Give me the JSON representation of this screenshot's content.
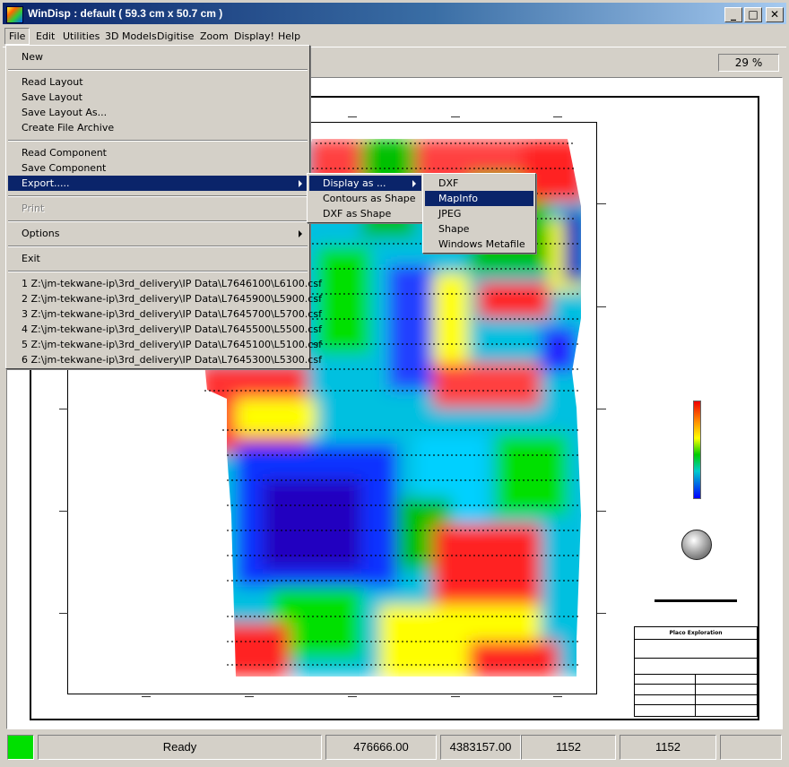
{
  "window": {
    "title": "WinDisp : default ( 59.3 cm x 50.7 cm )",
    "controls": {
      "minimize": "_",
      "maximize": "□",
      "close": "✕"
    }
  },
  "menubar": {
    "items": [
      "File",
      "Edit",
      "Utilities",
      "3D Models",
      "Digitise",
      "Zoom",
      "Display!",
      "Help"
    ]
  },
  "toolbar": {
    "zoom": "29 %"
  },
  "file_menu": {
    "new": "New",
    "read_layout": "Read Layout",
    "save_layout": "Save Layout",
    "save_layout_as": "Save Layout As...",
    "create_archive": "Create File Archive",
    "read_component": "Read Component",
    "save_component": "Save Component",
    "export": "Export.....",
    "print": "Print",
    "options": "Options",
    "exit": "Exit",
    "recent": [
      "1 Z:\\jm-tekwane-ip\\3rd_delivery\\IP Data\\L7646100\\L6100.csf",
      "2 Z:\\jm-tekwane-ip\\3rd_delivery\\IP Data\\L7645900\\L5900.csf",
      "3 Z:\\jm-tekwane-ip\\3rd_delivery\\IP Data\\L7645700\\L5700.csf",
      "4 Z:\\jm-tekwane-ip\\3rd_delivery\\IP Data\\L7645500\\L5500.csf",
      "5 Z:\\jm-tekwane-ip\\3rd_delivery\\IP Data\\L7645100\\L5100.csf",
      "6 Z:\\jm-tekwane-ip\\3rd_delivery\\IP Data\\L7645300\\L5300.csf"
    ]
  },
  "export_menu": {
    "display_as": "Display as ...",
    "contours_as_shape": "Contours as Shape",
    "dxf_as_shape": "DXF as Shape"
  },
  "display_as_menu": {
    "items": [
      "DXF",
      "MapInfo",
      "JPEG",
      "Shape",
      "Windows Metafile"
    ],
    "highlighted": "MapInfo"
  },
  "map": {
    "title_block": {
      "company": "Placo Exploration",
      "colors": {
        "red": "#e00000",
        "orange": "#ff8000",
        "yellow": "#ffff00",
        "green": "#00c000",
        "cyan": "#00c0c0",
        "blue": "#0000ff"
      }
    }
  },
  "statusbar": {
    "status": "Ready",
    "x": "476666.00",
    "y": "4383157.00",
    "v1": "1152",
    "v2": "1152"
  }
}
